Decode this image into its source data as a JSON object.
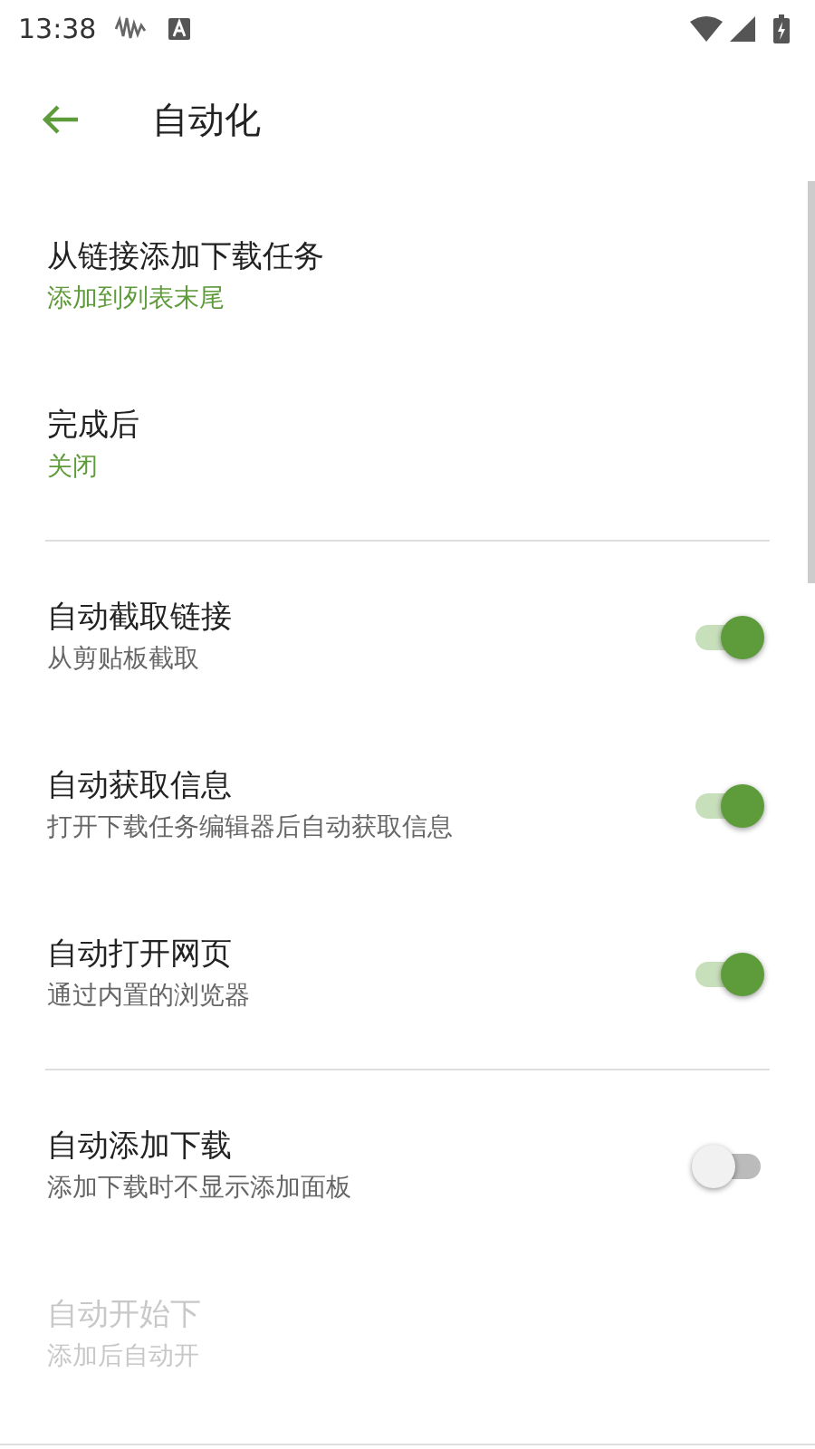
{
  "status_bar": {
    "time": "13:38"
  },
  "toolbar": {
    "title": "自动化"
  },
  "sections": [
    {
      "items": [
        {
          "kind": "value",
          "title": "从链接添加下载任务",
          "value": "添加到列表末尾"
        },
        {
          "kind": "value",
          "title": "完成后",
          "value": "关闭"
        }
      ]
    },
    {
      "items": [
        {
          "kind": "toggle",
          "title": "自动截取链接",
          "summary": "从剪贴板截取",
          "on": true
        },
        {
          "kind": "toggle",
          "title": "自动获取信息",
          "summary": "打开下载任务编辑器后自动获取信息",
          "on": true
        },
        {
          "kind": "toggle",
          "title": "自动打开网页",
          "summary": "通过内置的浏览器",
          "on": true
        }
      ]
    },
    {
      "items": [
        {
          "kind": "toggle",
          "title": "自动添加下载",
          "summary": "添加下载时不显示添加面板",
          "on": false
        },
        {
          "kind": "text",
          "title": "自动开始下",
          "summary": "添加后自动开",
          "disabled": true
        }
      ]
    }
  ]
}
